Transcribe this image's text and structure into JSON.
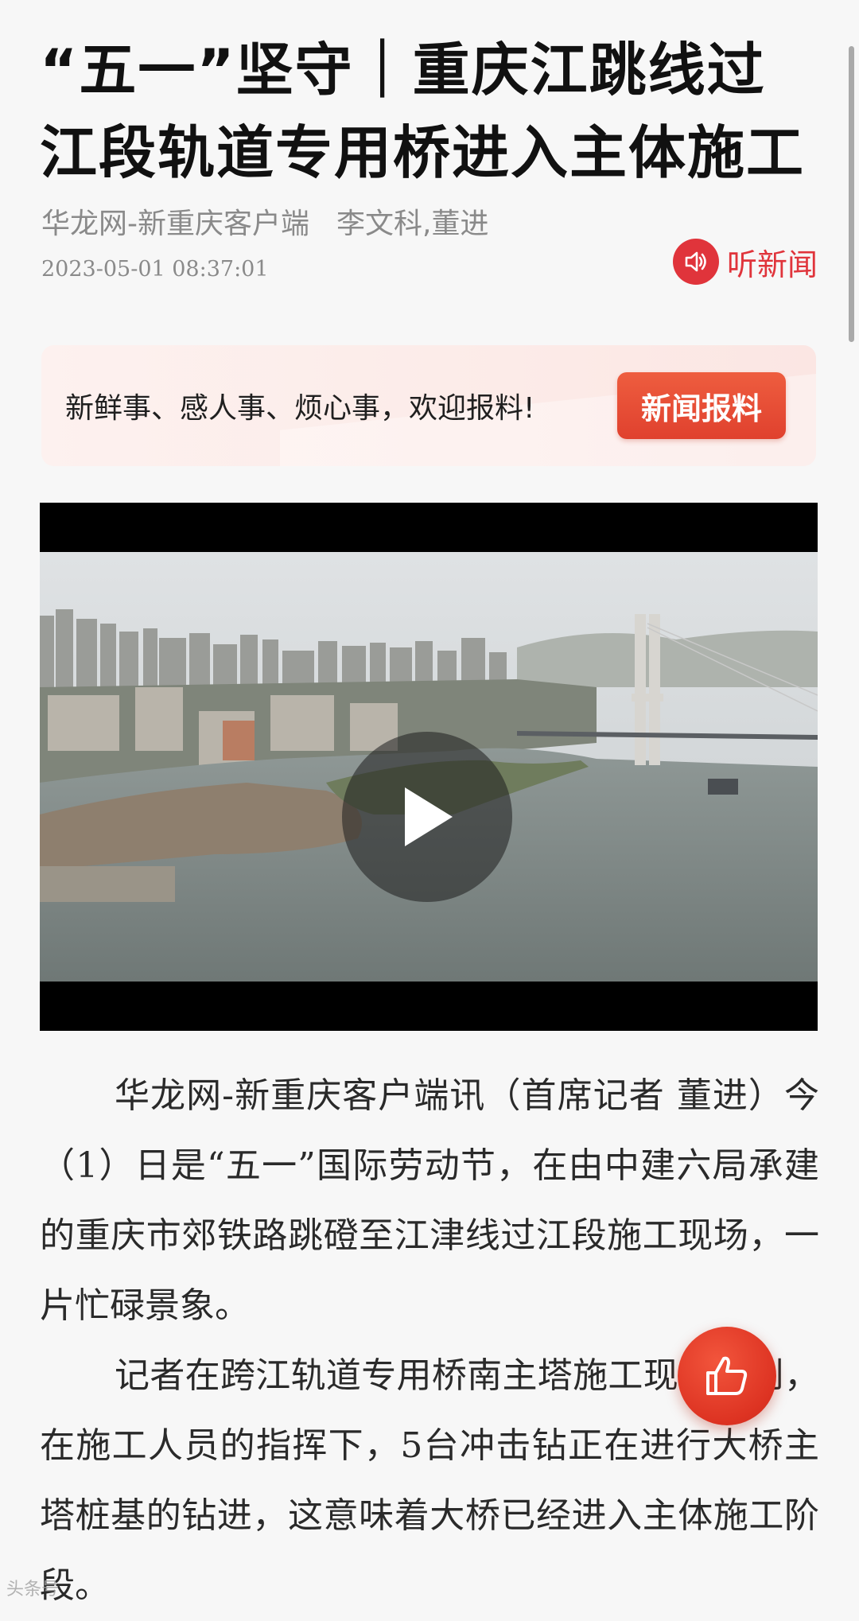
{
  "article": {
    "title": "“五一”坚守｜重庆江跳线过江段轨道专用桥进入主体施工",
    "source": "华龙网-新重庆客户端",
    "authors": "李文科,董进",
    "datetime": "2023-05-01 08:37:01",
    "listen_label": "听新闻",
    "paragraphs": [
      "华龙网-新重庆客户端讯（首席记者 董进）今（1）日是“五一”国际劳动节，在由中建六局承建的重庆市郊铁路跳磴至江津线过江段施工现场，一片忙碌景象。",
      "记者在跨江轨道专用桥南主塔施工现场看到，在施工人员的指挥下，5台冲击钻正在进行大桥主塔桩基的钻进，这意味着大桥已经进入主体施工阶段。"
    ]
  },
  "tip_banner": {
    "text": "新鲜事、感人事、烦心事，欢迎报料!",
    "button_label": "新闻报料"
  },
  "video": {
    "play_icon": "play-icon"
  },
  "like_button": {
    "icon": "thumbs-up-icon"
  },
  "watermark": "头条号"
}
